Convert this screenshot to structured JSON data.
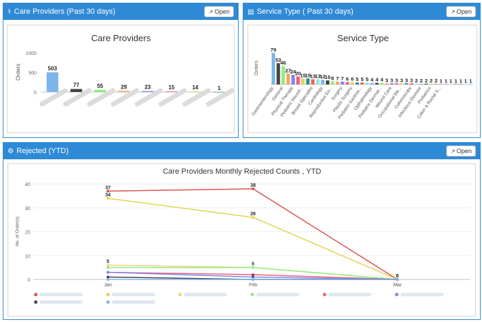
{
  "panels": {
    "care": {
      "title": "Care Providers (Past 30 days)",
      "open_label": "Open",
      "header_icon": "stethoscope-icon"
    },
    "service": {
      "title": "Service Type ( Past 30 days)",
      "open_label": "Open",
      "header_icon": "bar-chart-icon"
    },
    "rejected": {
      "title": "Rejected (YTD)",
      "open_label": "Open",
      "header_icon": "gear-icon"
    }
  },
  "open_icon": "external-link-icon",
  "chart_data": [
    {
      "type": "bar",
      "title": "Care Providers",
      "ylabel": "Orders",
      "xlabel": "",
      "ylim": [
        0,
        1000
      ],
      "yticks": [
        0,
        500,
        1000
      ],
      "values": [
        503,
        77,
        55,
        29,
        23,
        15,
        14,
        1
      ],
      "colors": [
        "#7cb5ec",
        "#434348",
        "#90ed7d",
        "#f7a35c",
        "#8085e9",
        "#f15c80",
        "#e4d354",
        "#2b908f"
      ],
      "grid": false,
      "legend": "none"
    },
    {
      "type": "bar",
      "title": "Service Type",
      "ylabel": "Orders",
      "xlabel": "",
      "categories": [
        "Gastroenterology",
        "General",
        "Physical Therapy",
        "Pediatric Neurol...",
        "Breast Specialist",
        "Cardiology",
        "Reproductive En...",
        "Surgery",
        "Plastic Surgery",
        "Pediatric Gastroe...",
        "Opthalmology",
        "Pediatric Dermat...",
        "Wound Care",
        "Occupational Me...",
        "Colonoscopy",
        "Infectious Disease",
        "Pediatrics",
        "Colon & Rectal S..."
      ],
      "tick_positions": [
        0,
        2,
        4,
        6,
        8,
        10,
        12,
        14,
        16,
        18,
        20,
        22,
        24,
        26,
        28,
        30,
        32,
        34
      ],
      "values": [
        79,
        53,
        46,
        27,
        24,
        20,
        15,
        15,
        13,
        13,
        12,
        10,
        8,
        7,
        7,
        6,
        6,
        5,
        5,
        5,
        4,
        4,
        4,
        3,
        3,
        3,
        3,
        3,
        3,
        2,
        2,
        2,
        2,
        2,
        1,
        1,
        1,
        1,
        1,
        1,
        1
      ],
      "colors": [
        "#7cb5ec",
        "#434348",
        "#90ed7d",
        "#f7a35c",
        "#8085e9",
        "#f15c80",
        "#e4d354",
        "#2b908f",
        "#f45b5b",
        "#91e8e1"
      ],
      "grid": false,
      "legend": "none"
    },
    {
      "type": "line",
      "title": "Care Providers Monthly Rejected Counts , YTD",
      "ylabel": "No. of Order(s)",
      "xlabel": "",
      "x": [
        "Jan",
        "Feb",
        "Mar"
      ],
      "ylim": [
        0,
        40
      ],
      "yticks": [
        0,
        10,
        20,
        30,
        40
      ],
      "series": [
        {
          "values": [
            37,
            38,
            0
          ],
          "color": "#d9534f",
          "labels": [
            "37",
            "38",
            "0"
          ]
        },
        {
          "values": [
            34,
            26,
            0
          ],
          "color": "#e4d354",
          "labels": [
            "34",
            "26",
            "0"
          ]
        },
        {
          "values": [
            6,
            5,
            0
          ],
          "color": "#f0d67a",
          "labels": [
            "5",
            "",
            ""
          ]
        },
        {
          "values": [
            5,
            5,
            0
          ],
          "color": "#90ed7d",
          "labels": [
            "",
            "5",
            ""
          ]
        },
        {
          "values": [
            3,
            2,
            0
          ],
          "color": "#f15c80",
          "labels": [
            "",
            "",
            ""
          ]
        },
        {
          "values": [
            3,
            1,
            0
          ],
          "color": "#8085e9",
          "labels": [
            "",
            "",
            ""
          ]
        },
        {
          "values": [
            1,
            0,
            0
          ],
          "color": "#434348",
          "labels": [
            "",
            "0",
            ""
          ]
        },
        {
          "values": [
            0,
            0,
            0
          ],
          "color": "#7cb5ec",
          "labels": [
            "",
            "",
            ""
          ]
        }
      ],
      "grid": "horizontal",
      "legend": "bottom"
    }
  ]
}
